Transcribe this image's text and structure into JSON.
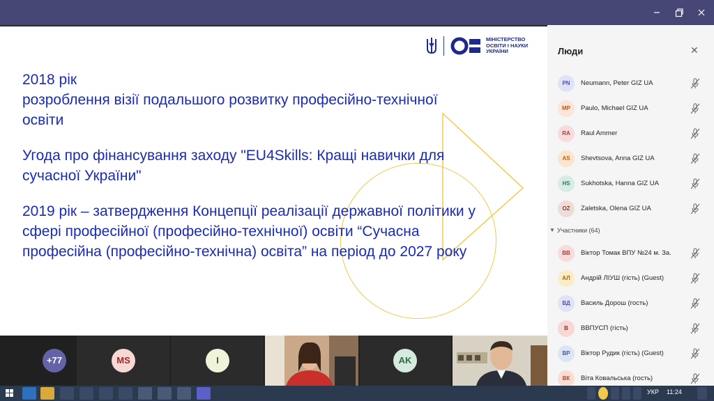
{
  "window": {
    "minimize_icon": "minimize-icon",
    "maximize_icon": "restore-icon",
    "close_icon": "close-icon"
  },
  "slide": {
    "logo_lines": [
      "МІНІСТЕРСТВО",
      "ОСВІТИ І НАУКИ",
      "УКРАЇНИ"
    ],
    "paragraphs": [
      [
        "2018 рік",
        "розроблення візії подальшого розвитку професійно-технічної",
        "освіти"
      ],
      [
        "Угода про фінансування заходу \"EU4Skills: Кращі навички для",
        "сучасної України\""
      ],
      [
        "2019 рік – затвердження Концепції реалізації державної політики у",
        "сфері професійної (професійно-технічної) освіти “Сучасна",
        "професійна (професійно-технічна) освіта” на період до 2027 року"
      ]
    ],
    "text_color": "#1a2bb5",
    "accent_color": "#f2c94c"
  },
  "video_strip": {
    "overflow_count": "+77",
    "tiles": [
      {
        "initials": "MS",
        "bg": "#f6d8d5",
        "fg": "#a4262c"
      },
      {
        "initials": "I",
        "bg": "#eef3d9",
        "fg": "#4a5a1a"
      },
      {
        "initials": "AK",
        "bg": "#d6eadf",
        "fg": "#2e6b43"
      }
    ]
  },
  "people_panel": {
    "title": "Люди",
    "close_icon": "close-icon",
    "organizers": [
      {
        "initials": "PN",
        "name": "Neumann, Peter GIZ UA",
        "bg": "#dfe3f5",
        "fg": "#4f52b2"
      },
      {
        "initials": "MP",
        "name": "Paulo, Michael GIZ UA",
        "bg": "#fbe5d6",
        "fg": "#c4541a"
      },
      {
        "initials": "RA",
        "name": "Raul Ammer",
        "bg": "#f6dcdc",
        "fg": "#b13a3a"
      },
      {
        "initials": "AS",
        "name": "Shevtsova, Anna GIZ UA",
        "bg": "#fbe5cf",
        "fg": "#b5651d"
      },
      {
        "initials": "HS",
        "name": "Sukhotska, Hanna GIZ UA",
        "bg": "#d8ece6",
        "fg": "#2f7a5f"
      },
      {
        "initials": "OZ",
        "name": "Zaletska, Olena GIZ UA",
        "bg": "#eddcd7",
        "fg": "#8a3f2e"
      }
    ],
    "participants_label": "Участники (64)",
    "participants": [
      {
        "initials": "ВВ",
        "name": "Віктор Томак ВПУ №24 м. За.",
        "bg": "#f6dcdc",
        "fg": "#b13a3a"
      },
      {
        "initials": "АЛ",
        "name": "Андрій ЛІУШ (гість) (Guest)",
        "bg": "#fbecc8",
        "fg": "#9a6a00"
      },
      {
        "initials": "ВД",
        "name": "Василь Дорош (гость)",
        "bg": "#dfe3f5",
        "fg": "#4f52b2"
      },
      {
        "initials": "В",
        "name": "ВВПУСП (гість)",
        "bg": "#f6d8d5",
        "fg": "#a4262c"
      },
      {
        "initials": "ВР",
        "name": "Віктор Рудик (гість) (Guest)",
        "bg": "#dde4f3",
        "fg": "#3b5ca8"
      },
      {
        "initials": "ВК",
        "name": "Віта Ковальська (гость)",
        "bg": "#f9dcd2",
        "fg": "#b4432a"
      }
    ],
    "mic_icon": "muted-mic-icon"
  },
  "taskbar": {
    "language": "УКР",
    "time": "11:24"
  }
}
